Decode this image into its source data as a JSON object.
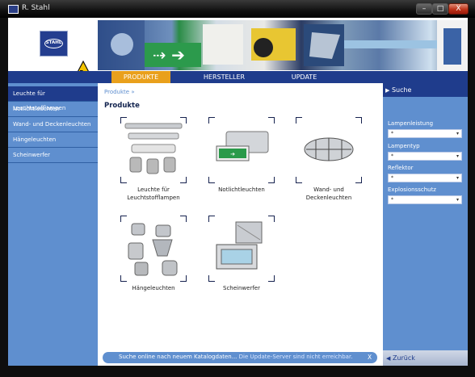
{
  "window": {
    "title": "R. Stahl",
    "controls": {
      "minimize": "–",
      "maximize": "□",
      "close": "X"
    }
  },
  "logo": {
    "text": "STAHL"
  },
  "ex_symbol": "Ex",
  "nav": {
    "tabs": [
      {
        "label": "PRODUKTE",
        "active": true
      },
      {
        "label": "HERSTELLER",
        "active": false
      },
      {
        "label": "UPDATE",
        "active": false
      }
    ]
  },
  "sidebar": {
    "items": [
      {
        "label": "Leuchte für Leuchtstofflampen",
        "active": true
      },
      {
        "label": "Notlichtleuchten",
        "active": false
      },
      {
        "label": "Wand- und Deckenleuchten",
        "active": false
      },
      {
        "label": "Hängeleuchten",
        "active": false
      },
      {
        "label": "Scheinwerfer",
        "active": false
      }
    ]
  },
  "main": {
    "breadcrumb": "Produkte »",
    "heading": "Produkte",
    "products": [
      {
        "label": "Leuchte für Leuchtstofflampen",
        "icon": "fluorescent-luminaires-image"
      },
      {
        "label": "Notlichtleuchten",
        "icon": "emergency-light-image"
      },
      {
        "label": "Wand- und Deckenleuchten",
        "icon": "wall-ceiling-light-image"
      },
      {
        "label": "Hängeleuchten",
        "icon": "pendant-light-image"
      },
      {
        "label": "Scheinwerfer",
        "icon": "floodlight-image"
      }
    ]
  },
  "right_panel": {
    "title": "Suche",
    "filters": [
      {
        "label": "Lampenleistung",
        "value": "*"
      },
      {
        "label": "Lampentyp",
        "value": "*"
      },
      {
        "label": "Reflektor",
        "value": "*"
      },
      {
        "label": "Explosionsschutz",
        "value": "*"
      }
    ],
    "back_label": "Zurück"
  },
  "status": {
    "text": "Suche online nach neuem Katalogdaten...",
    "link": "Die Update-Server sind nicht erreichbar.",
    "close": "X"
  },
  "colors": {
    "nav": "#1f3c8c",
    "active_tab": "#e9a01c",
    "panel": "#5f8fcf"
  }
}
